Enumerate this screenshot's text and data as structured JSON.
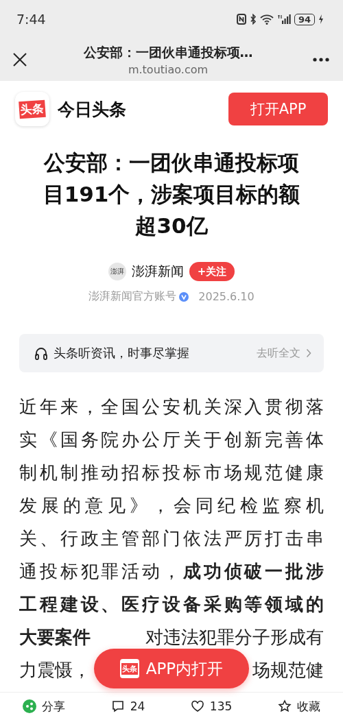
{
  "status_bar": {
    "time": "7:44",
    "battery": "94"
  },
  "browser": {
    "title": "公安部：一团伙串通投标项…",
    "url": "m.toutiao.com"
  },
  "app_bar": {
    "logo": "头条",
    "app_name": "今日头条",
    "open_button": "打开APP"
  },
  "article": {
    "title": "公安部：一团伙串通投标项目191个，涉案项目标的额超30亿",
    "author": {
      "avatar": "澎湃",
      "name": "澎湃新闻",
      "follow": "+关注",
      "account": "澎湃新闻官方账号",
      "verified": true,
      "date": "2025.6.10"
    },
    "listen": {
      "text": "头条听资讯，时事尽掌握",
      "link": "去听全文"
    },
    "lines": [
      {
        "segments": [
          {
            "text": "近年来，全国公安机关深入贯彻落",
            "bold": false
          }
        ]
      },
      {
        "segments": [
          {
            "text": "实《国务院办公厅关于创新完善体",
            "bold": false
          }
        ]
      },
      {
        "segments": [
          {
            "text": "制机制推动招标投标市场规范健康",
            "bold": false
          }
        ]
      },
      {
        "segments": [
          {
            "text": "发展的意见》，会同纪检监察机",
            "bold": false
          }
        ]
      },
      {
        "segments": [
          {
            "text": "关、行政主管部门依法严厉打击串",
            "bold": false
          }
        ]
      },
      {
        "segments": [
          {
            "text": "通投标犯罪活动，",
            "bold": false
          },
          {
            "text": "成功侦破一批涉",
            "bold": true
          }
        ]
      },
      {
        "segments": [
          {
            "text": "工程建设、医疗设备采购等领域的",
            "bold": true
          }
        ]
      },
      {
        "segments": [
          {
            "text": "大要案件",
            "bold": true
          }
        ],
        "tail": "对违法犯罪分子形成有"
      },
      {
        "segments": [
          {
            "text": "力震慑，",
            "bold": false
          }
        ],
        "tail": "场规范健"
      }
    ]
  },
  "float_button": {
    "logo": "头条",
    "label": "APP内打开"
  },
  "bottom_bar": [
    {
      "kind": "share",
      "label": "分享"
    },
    {
      "kind": "comment",
      "label": "24"
    },
    {
      "kind": "like",
      "label": "135"
    },
    {
      "kind": "favorite",
      "label": "收藏"
    }
  ]
}
